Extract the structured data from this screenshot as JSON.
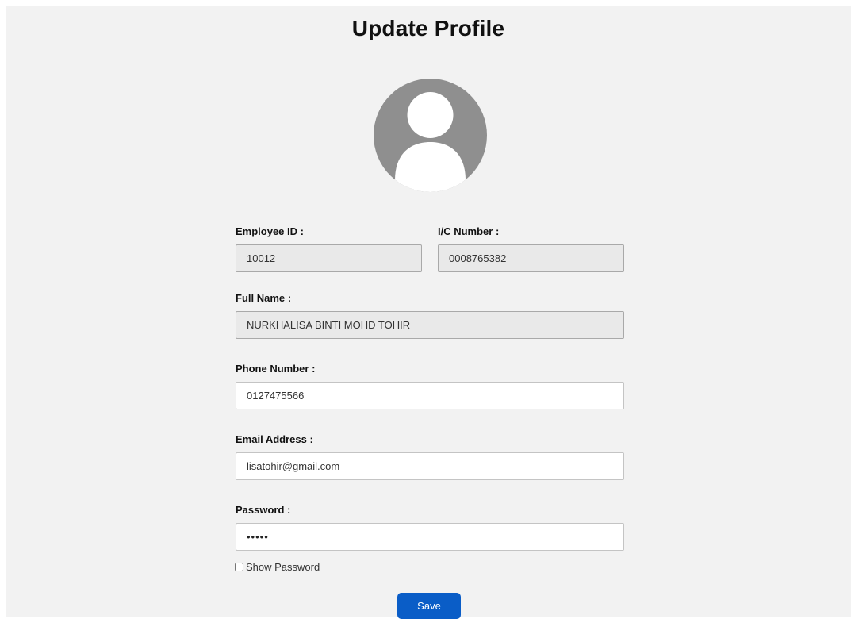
{
  "page": {
    "title": "Update Profile"
  },
  "avatar": {
    "icon": "user-avatar-icon"
  },
  "form": {
    "employee_id": {
      "label": "Employee ID :",
      "value": "10012"
    },
    "ic_number": {
      "label": "I/C Number :",
      "value": "0008765382"
    },
    "full_name": {
      "label": "Full Name :",
      "value": "NURKHALISA BINTI MOHD TOHIR"
    },
    "phone_number": {
      "label": "Phone Number :",
      "value": "0127475566"
    },
    "email_address": {
      "label": "Email Address :",
      "value": "lisatohir@gmail.com"
    },
    "password": {
      "label": "Password :",
      "value": "•••••"
    },
    "show_password": {
      "label": "Show Password",
      "checked": false
    },
    "save_label": "Save"
  },
  "colors": {
    "panel_background": "#f2f2f2",
    "readonly_field": "#e9e9e9",
    "save_button": "#0a5dc7",
    "avatar_gray": "#8f8f8f"
  }
}
